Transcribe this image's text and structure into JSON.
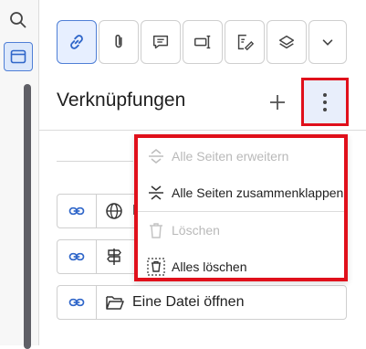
{
  "panel": {
    "title": "Verknüpfungen"
  },
  "left_rail": {
    "items": [
      {
        "icon": "search-icon"
      },
      {
        "icon": "document-panel-icon",
        "active": true
      }
    ]
  },
  "toolbar": {
    "buttons": [
      {
        "icon": "link-icon",
        "active": true
      },
      {
        "icon": "paperclip-icon"
      },
      {
        "icon": "comment-icon"
      },
      {
        "icon": "form-field-icon"
      },
      {
        "icon": "signature-icon"
      },
      {
        "icon": "layers-icon"
      },
      {
        "icon": "chevron-down-icon"
      }
    ]
  },
  "links": [
    {
      "icon": "globe-icon",
      "label": "E"
    },
    {
      "icon": "signpost-icon",
      "label": ""
    },
    {
      "icon": "folder-open-icon",
      "label": "Eine Datei öffnen"
    }
  ],
  "menu": {
    "items": [
      {
        "label": "Alle Seiten erweitern",
        "enabled": false,
        "icon": "expand-icon"
      },
      {
        "label": "Alle Seiten zusammenklappen",
        "enabled": true,
        "icon": "collapse-icon"
      },
      {
        "label": "Löschen",
        "enabled": false,
        "icon": "trash-icon"
      },
      {
        "label": "Alles löschen",
        "enabled": true,
        "icon": "delete-all-icon"
      }
    ]
  },
  "colors": {
    "accent": "#2f66c9",
    "highlight": "#e0101b",
    "active_bg": "#e7efff"
  }
}
